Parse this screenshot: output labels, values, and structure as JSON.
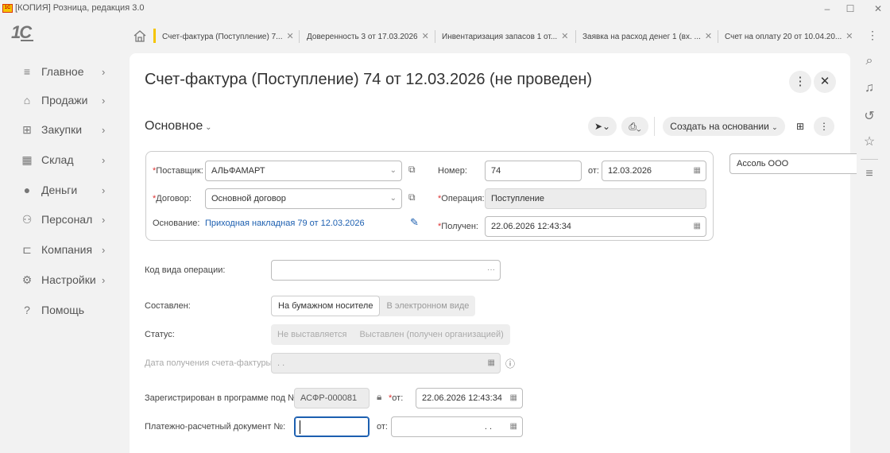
{
  "window": {
    "title": "[КОПИЯ] Розница, редакция 3.0",
    "minimize": "–",
    "maximize": "☐",
    "close": "✕"
  },
  "tabs": [
    {
      "label": "Счет-фактура (Поступление) 7..."
    },
    {
      "label": "Доверенность 3 от 17.03.2026"
    },
    {
      "label": "Инвентаризация запасов 1 от..."
    },
    {
      "label": "Заявка на расход денег 1 (вх. ..."
    },
    {
      "label": "Счет на оплату 20 от 10.04.20..."
    }
  ],
  "sidebar": {
    "items": [
      {
        "label": "Главное",
        "icon": "menu-icon"
      },
      {
        "label": "Продажи",
        "icon": "store-icon"
      },
      {
        "label": "Закупки",
        "icon": "purchases-icon"
      },
      {
        "label": "Склад",
        "icon": "warehouse-icon"
      },
      {
        "label": "Деньги",
        "icon": "money-icon"
      },
      {
        "label": "Персонал",
        "icon": "people-icon"
      },
      {
        "label": "Компания",
        "icon": "company-icon"
      },
      {
        "label": "Настройки",
        "icon": "gear-icon"
      },
      {
        "label": "Помощь",
        "icon": "help-icon"
      }
    ]
  },
  "document": {
    "title": "Счет-фактура (Поступление) 74 от 12.03.2026 (не проведен)",
    "section": "Основное",
    "create_based_on": "Создать на основании"
  },
  "header": {
    "supplier_label": "Поставщик:",
    "supplier_value": "АЛЬФАМАРТ",
    "contract_label": "Договор:",
    "contract_value": "Основной договор",
    "basis_label": "Основание:",
    "basis_link": "Приходная накладная 79 от 12.03.2026",
    "number_label": "Номер:",
    "number_value": "74",
    "from_label": "от:",
    "date_value": "12.03.2026",
    "operation_label": "Операция:",
    "operation_value": "Поступление",
    "received_label": "Получен:",
    "received_value": "22.06.2026 12:43:34"
  },
  "organization": "Ассоль ООО",
  "form": {
    "op_code_label": "Код вида операции:",
    "op_code_value": "",
    "compiled_label": "Составлен:",
    "compiled_options": [
      "На бумажном носителе",
      "В электронном виде"
    ],
    "compiled_selected": "На бумажном носителе",
    "status_label": "Статус:",
    "status_options": [
      "Не выставляется",
      "Выставлен (получен организацией)"
    ],
    "receipt_date_label": "Дата получения счета-фактуры:",
    "receipt_date_value": ". .",
    "registered_label": "Зарегистрирован в программе под №:",
    "registered_value": "АСФР-000081",
    "registered_from_label": "от:",
    "registered_date": "22.06.2026 12:43:34",
    "payment_doc_label": "Платежно-расчетный документ №:",
    "payment_doc_value": "",
    "payment_from_label": "от:",
    "payment_date": ". ."
  },
  "colors": {
    "accent": "#f5c500",
    "link": "#1c5fb0",
    "required": "#dd3333"
  }
}
